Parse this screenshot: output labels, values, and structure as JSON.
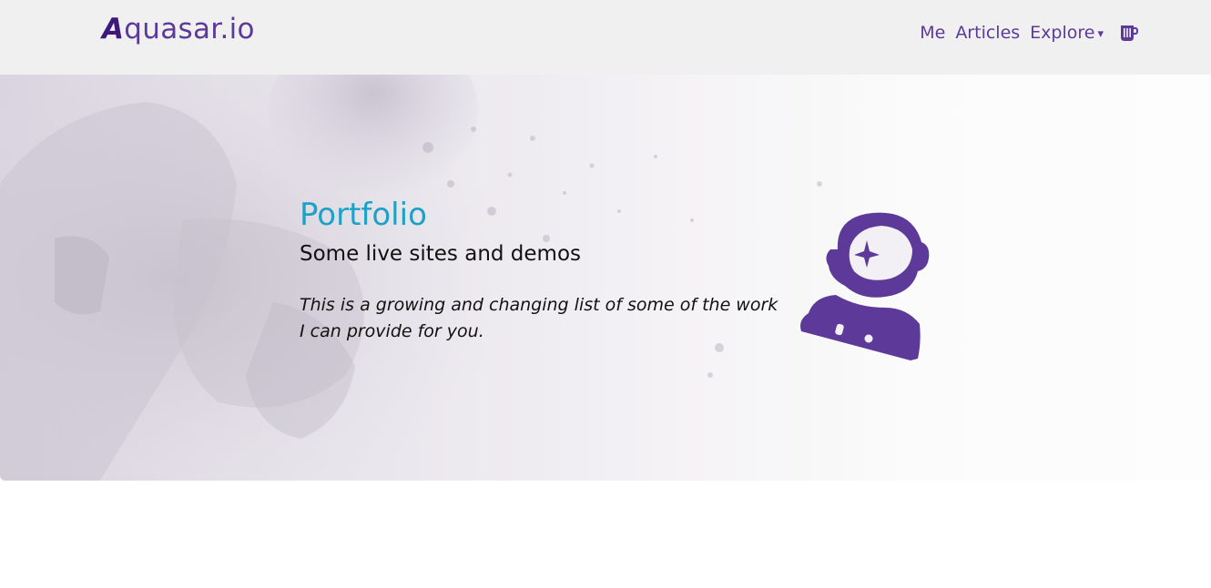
{
  "header": {
    "logo_first_letter": "A",
    "logo_rest": "quasar.io",
    "nav": {
      "me": "Me",
      "articles": "Articles",
      "explore": "Explore",
      "explore_caret": "▾"
    },
    "coffee_icon": "coffee-cup-icon"
  },
  "hero": {
    "title": "Portfolio",
    "subtitle": "Some live sites and demos",
    "text": "This is a growing and changing list of some of the work I can provide for you.",
    "mascot_icon": "astronaut-icon"
  },
  "colors": {
    "brand": "#5d3a99",
    "title": "#1ea1c6",
    "navbar_bg": "#f0f0f1"
  }
}
